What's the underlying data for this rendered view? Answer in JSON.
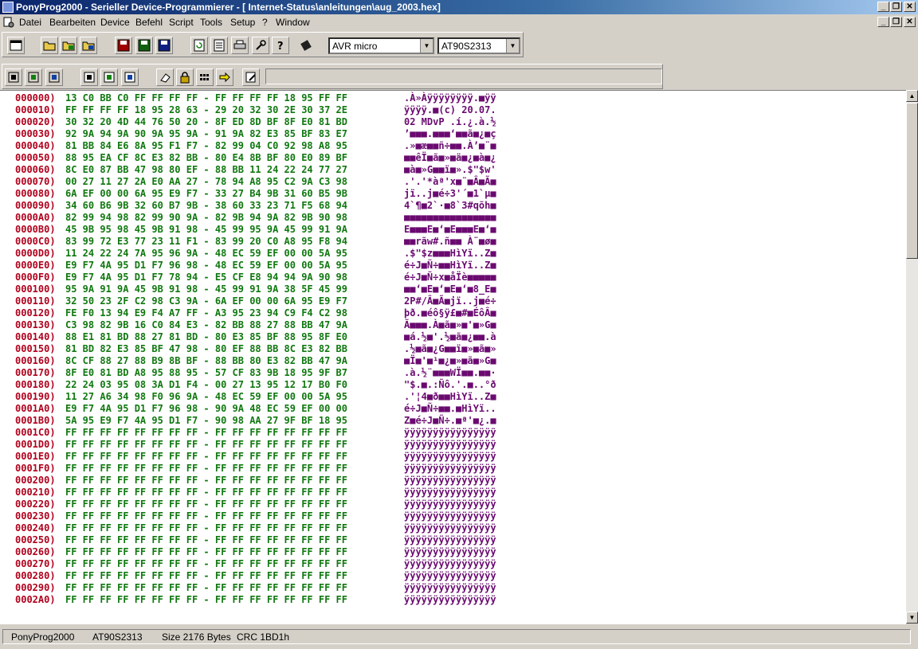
{
  "window": {
    "title": "PonyProg2000 - Serieller Device-Programmierer - [ Internet-Status\\anleitungen\\aug_2003.hex]",
    "buttons": {
      "minimize": "_",
      "restore": "❐",
      "close": "✕"
    }
  },
  "menu": {
    "items": [
      "Datei",
      "Bearbeiten",
      "Device",
      "Befehl",
      "Script",
      "Tools",
      "Setup",
      "?",
      "Window"
    ]
  },
  "toolbar": {
    "device_family": "AVR micro",
    "device_type": "AT90S2313"
  },
  "hex_view": {
    "rows": [
      {
        "addr": "000000)",
        "hex": "13 C0 BB C0 FF FF FF FF - FF FF FF FF 18 95 FF FF",
        "ascii": ".À»Àÿÿÿÿÿÿÿÿ.■ÿÿ"
      },
      {
        "addr": "000010)",
        "hex": "FF FF FF FF 18 95 28 63 - 29 20 32 30 2E 30 37 2E",
        "ascii": "ÿÿÿÿ.■(c) 20.07."
      },
      {
        "addr": "000020)",
        "hex": "30 32 20 4D 44 76 50 20 - 8F ED 8D BF 8F E0 81 BD",
        "ascii": "02 MDvP .í.¿.à.½"
      },
      {
        "addr": "000030)",
        "hex": "92 9A 94 9A 90 9A 95 9A - 91 9A 82 E3 85 BF 83 E7",
        "ascii": "’■■■.■■■‘■■ã■¿■ç"
      },
      {
        "addr": "000040)",
        "hex": "81 BB 84 E6 8A 95 F1 F7 - 82 99 04 C0 92 98 A8 95",
        "ascii": ".»■æ■■ñ÷■■.À’■¨■"
      },
      {
        "addr": "000050)",
        "hex": "88 95 EA CF 8C E3 82 BB - 80 E4 8B BF 80 E0 89 BF",
        "ascii": "■■êÏ■ã■»■ä■¿■à■¿"
      },
      {
        "addr": "000060)",
        "hex": "8C E0 87 BB 47 98 80 EF - 88 BB 11 24 22 24 77 27",
        "ascii": "■à■»G■■ï■».$\"$w'"
      },
      {
        "addr": "000070)",
        "hex": "00 27 11 27 2A E0 AA 27 - 78 94 A8 95 C2 9A C3 98",
        "ascii": ".'.'*àª'x■¨■Â■Ã■"
      },
      {
        "addr": "000080)",
        "hex": "6A EF 00 00 6A 95 E9 F7 - 33 27 B4 9B 31 60 B5 9B",
        "ascii": "jï..j■é÷3'´■1`µ■"
      },
      {
        "addr": "000090)",
        "hex": "34 60 B6 9B 32 60 B7 9B - 38 60 33 23 71 F5 68 94",
        "ascii": "4`¶■2`·■8`3#qõh■"
      },
      {
        "addr": "0000A0)",
        "hex": "82 99 94 98 82 99 90 9A - 82 9B 94 9A 82 9B 90 98",
        "ascii": "■■■■■■■■■■■■■■■■"
      },
      {
        "addr": "0000B0)",
        "hex": "45 9B 95 98 45 9B 91 98 - 45 99 95 9A 45 99 91 9A",
        "ascii": "E■■■E■‘■E■■■E■‘■"
      },
      {
        "addr": "0000C0)",
        "hex": "83 99 72 E3 77 23 11 F1 - 83 99 20 C0 A8 95 F8 94",
        "ascii": "■■rãw#.ñ■■ À¨■ø■"
      },
      {
        "addr": "0000D0)",
        "hex": "11 24 22 24 7A 95 96 9A - 48 EC 59 EF 00 00 5A 95",
        "ascii": ".$\"$z■■■HìYï..Z■"
      },
      {
        "addr": "0000E0)",
        "hex": "E9 F7 4A 95 D1 F7 96 98 - 48 EC 59 EF 00 00 5A 95",
        "ascii": "é÷J■Ñ÷■■HìYï..Z■"
      },
      {
        "addr": "0000F0)",
        "hex": "E9 F7 4A 95 D1 F7 78 94 - E5 CF E8 94 94 9A 90 98",
        "ascii": "é÷J■Ñ÷x■åÏè■■■■■"
      },
      {
        "addr": "000100)",
        "hex": "95 9A 91 9A 45 9B 91 98 - 45 99 91 9A 38 5F 45 99",
        "ascii": "■■‘■E■‘■E■‘■8_E■"
      },
      {
        "addr": "000110)",
        "hex": "32 50 23 2F C2 98 C3 9A - 6A EF 00 00 6A 95 E9 F7",
        "ascii": "2P#/Â■Ã■jï..j■é÷"
      },
      {
        "addr": "000120)",
        "hex": "FE F0 13 94 E9 F4 A7 FF - A3 95 23 94 C9 F4 C2 98",
        "ascii": "þð.■éô§ÿ£■#■ÉôÂ■"
      },
      {
        "addr": "000130)",
        "hex": "C3 98 82 9B 16 C0 84 E3 - 82 BB 88 27 88 BB 47 9A",
        "ascii": "Ã■■■.À■ã■»■'■»G■"
      },
      {
        "addr": "000140)",
        "hex": "88 E1 81 BD 88 27 81 BD - 80 E3 85 BF 88 95 8F E0",
        "ascii": "■á.½■'.½■ã■¿■■.à"
      },
      {
        "addr": "000150)",
        "hex": "81 BD 82 E3 85 BF 47 98 - 80 EF 88 BB 8C E3 82 BB",
        "ascii": ".½■ã■¿G■■ï■»■ã■»"
      },
      {
        "addr": "000160)",
        "hex": "8C CF 88 27 88 B9 8B BF - 88 BB 80 E3 82 BB 47 9A",
        "ascii": "■Ï■'■¹■¿■»■ã■»G■"
      },
      {
        "addr": "000170)",
        "hex": "8F E0 81 BD A8 95 88 95 - 57 CF 83 9B 18 95 9F B7",
        "ascii": ".à.½¨■■■WÏ■■.■■·"
      },
      {
        "addr": "000180)",
        "hex": "22 24 03 95 08 3A D1 F4 - 00 27 13 95 12 17 B0 F0",
        "ascii": "\"$.■.:Ñô.'.■..°ð"
      },
      {
        "addr": "000190)",
        "hex": "11 27 A6 34 98 F0 96 9A - 48 EC 59 EF 00 00 5A 95",
        "ascii": ".'¦4■ð■■HìYï..Z■"
      },
      {
        "addr": "0001A0)",
        "hex": "E9 F7 4A 95 D1 F7 96 98 - 90 9A 48 EC 59 EF 00 00",
        "ascii": "é÷J■Ñ÷■■.■HìYï.."
      },
      {
        "addr": "0001B0)",
        "hex": "5A 95 E9 F7 4A 95 D1 F7 - 90 98 AA 27 9F BF 18 95",
        "ascii": "Z■é÷J■Ñ÷.■ª'■¿.■"
      },
      {
        "addr": "0001C0)",
        "hex": "FF FF FF FF FF FF FF FF - FF FF FF FF FF FF FF FF",
        "ascii": "ÿÿÿÿÿÿÿÿÿÿÿÿÿÿÿÿ"
      },
      {
        "addr": "0001D0)",
        "hex": "FF FF FF FF FF FF FF FF - FF FF FF FF FF FF FF FF",
        "ascii": "ÿÿÿÿÿÿÿÿÿÿÿÿÿÿÿÿ"
      },
      {
        "addr": "0001E0)",
        "hex": "FF FF FF FF FF FF FF FF - FF FF FF FF FF FF FF FF",
        "ascii": "ÿÿÿÿÿÿÿÿÿÿÿÿÿÿÿÿ"
      },
      {
        "addr": "0001F0)",
        "hex": "FF FF FF FF FF FF FF FF - FF FF FF FF FF FF FF FF",
        "ascii": "ÿÿÿÿÿÿÿÿÿÿÿÿÿÿÿÿ"
      },
      {
        "addr": "000200)",
        "hex": "FF FF FF FF FF FF FF FF - FF FF FF FF FF FF FF FF",
        "ascii": "ÿÿÿÿÿÿÿÿÿÿÿÿÿÿÿÿ"
      },
      {
        "addr": "000210)",
        "hex": "FF FF FF FF FF FF FF FF - FF FF FF FF FF FF FF FF",
        "ascii": "ÿÿÿÿÿÿÿÿÿÿÿÿÿÿÿÿ"
      },
      {
        "addr": "000220)",
        "hex": "FF FF FF FF FF FF FF FF - FF FF FF FF FF FF FF FF",
        "ascii": "ÿÿÿÿÿÿÿÿÿÿÿÿÿÿÿÿ"
      },
      {
        "addr": "000230)",
        "hex": "FF FF FF FF FF FF FF FF - FF FF FF FF FF FF FF FF",
        "ascii": "ÿÿÿÿÿÿÿÿÿÿÿÿÿÿÿÿ"
      },
      {
        "addr": "000240)",
        "hex": "FF FF FF FF FF FF FF FF - FF FF FF FF FF FF FF FF",
        "ascii": "ÿÿÿÿÿÿÿÿÿÿÿÿÿÿÿÿ"
      },
      {
        "addr": "000250)",
        "hex": "FF FF FF FF FF FF FF FF - FF FF FF FF FF FF FF FF",
        "ascii": "ÿÿÿÿÿÿÿÿÿÿÿÿÿÿÿÿ"
      },
      {
        "addr": "000260)",
        "hex": "FF FF FF FF FF FF FF FF - FF FF FF FF FF FF FF FF",
        "ascii": "ÿÿÿÿÿÿÿÿÿÿÿÿÿÿÿÿ"
      },
      {
        "addr": "000270)",
        "hex": "FF FF FF FF FF FF FF FF - FF FF FF FF FF FF FF FF",
        "ascii": "ÿÿÿÿÿÿÿÿÿÿÿÿÿÿÿÿ"
      },
      {
        "addr": "000280)",
        "hex": "FF FF FF FF FF FF FF FF - FF FF FF FF FF FF FF FF",
        "ascii": "ÿÿÿÿÿÿÿÿÿÿÿÿÿÿÿÿ"
      },
      {
        "addr": "000290)",
        "hex": "FF FF FF FF FF FF FF FF - FF FF FF FF FF FF FF FF",
        "ascii": "ÿÿÿÿÿÿÿÿÿÿÿÿÿÿÿÿ"
      },
      {
        "addr": "0002A0)",
        "hex": "FF FF FF FF FF FF FF FF - FF FF FF FF FF FF FF FF",
        "ascii": "ÿÿÿÿÿÿÿÿÿÿÿÿÿÿÿÿ"
      }
    ]
  },
  "statusbar": {
    "app": "PonyProg2000",
    "device": "AT90S2313",
    "size": "Size  2176 Bytes",
    "crc": "CRC  1BD1h"
  }
}
